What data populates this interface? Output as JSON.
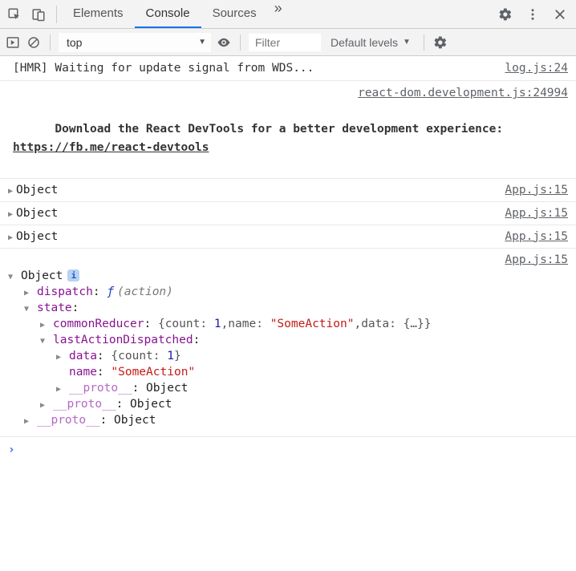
{
  "tabs": {
    "elements": "Elements",
    "console": "Console",
    "sources": "Sources"
  },
  "toolbar": {
    "context": "top",
    "filter_placeholder": "Filter",
    "levels": "Default levels"
  },
  "log": {
    "hmr_msg": "[HMR] Waiting for update signal from WDS...",
    "hmr_src": "log.js:24",
    "react_src": "react-dom.development.js:24994",
    "react_msg_1": "Download the React DevTools for a better development experience: ",
    "react_link": "https://fb.me/react-devtools"
  },
  "obj_label": "Object",
  "app_src": "App.js:15",
  "tree": {
    "dispatch_key": "dispatch",
    "dispatch_sig": "(action)",
    "state_key": "state",
    "commonReducer_key": "commonReducer",
    "commonReducer_preview_count_k": "count",
    "commonReducer_preview_count_v": "1",
    "commonReducer_preview_name_k": "name",
    "commonReducer_preview_name_v": "\"SomeAction\"",
    "commonReducer_preview_data_k": "data",
    "commonReducer_preview_data_v": "{…}",
    "lastAction_key": "lastActionDispatched",
    "data_key": "data",
    "data_preview_k": "count",
    "data_preview_v": "1",
    "name_key": "name",
    "name_val": "\"SomeAction\"",
    "proto_key": "__proto__",
    "proto_val": "Object",
    "f_glyph": "ƒ"
  },
  "info_badge": "i"
}
